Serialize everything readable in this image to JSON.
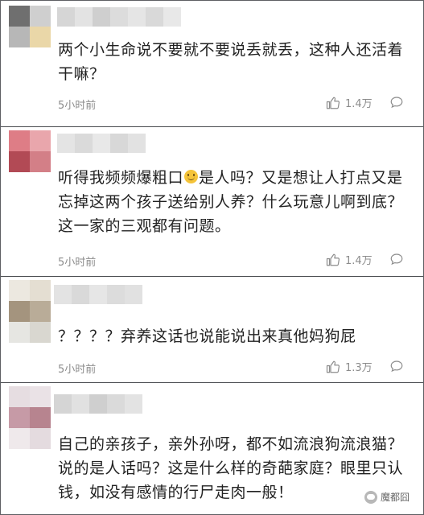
{
  "comments": [
    {
      "text": "两个小生命说不要就不要说丢就丢，这种人还活着干嘛？",
      "time": "5小时前",
      "likes": "1.4万",
      "avatar_colors": [
        "#6f6f6f",
        "#cfcfcf",
        "#b7b7b7",
        "#ead7a8"
      ],
      "name_colors": [
        "#d6d6d6",
        "#e3e3e3",
        "#cfcfcf",
        "#dcdcdc",
        "#e5e5e5",
        "#d9d9d9",
        "#e8e8e8"
      ]
    },
    {
      "text_before": "听得我频频爆粗口",
      "text_after": "是人吗？又是想让人打点又是忘掉这两个孩子送给别人养？什么玩意儿啊到底？这一家的三观都有问题。",
      "emoji": "smile-emoji",
      "time": "5小时前",
      "likes": "1.4万",
      "avatar_colors": [
        "#de7d86",
        "#e9a6ac",
        "#b24a55",
        "#d37f87"
      ],
      "name_colors": [
        "#e4e4e4",
        "#dadada",
        "#e8e8e8",
        "#d8d8d8",
        "#e2e2e2"
      ]
    },
    {
      "text": "？？？？弃养这话也说能说出来真他妈狗屁",
      "time": "5小时前",
      "likes": "1.3万",
      "avatar_colors": [
        "#ece8e0",
        "#e4ded2",
        "#a4947e",
        "#b9ac98",
        "#e6e6e2",
        "#d9d7d0"
      ],
      "name_colors": [
        "#e3e3e3",
        "#d9d9d9",
        "#e6e6e6",
        "#dcdcdc",
        "#e1e1e1"
      ]
    },
    {
      "text": "自己的亲孩子，亲外孙呀，都不如流浪狗流浪猫？说的是人话吗？这是什么样的奇葩家庭？眼里只认钱，如没有感情的行尸走肉一般！",
      "avatar_colors": [
        "#e6dde1",
        "#eae2e6",
        "#c69aa6",
        "#b7848f",
        "#efe9eb",
        "#e4dbdf"
      ],
      "name_colors": [
        "#d5d5d5",
        "#e1e1e1",
        "#cfcfcf",
        "#dadada",
        "#e3e3e3"
      ]
    }
  ],
  "icons": {
    "like": "thumbs-up-icon",
    "reply": "comment-bubble-icon"
  },
  "watermark": {
    "text": "魔都囧"
  }
}
